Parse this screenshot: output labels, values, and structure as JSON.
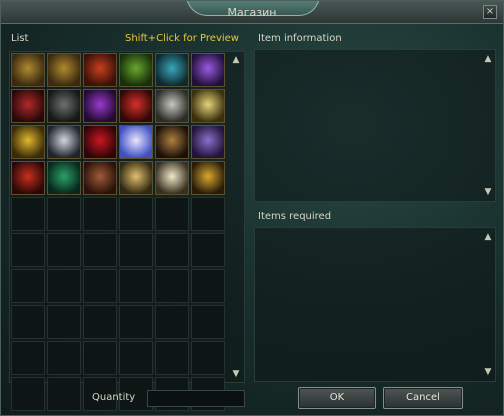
{
  "window": {
    "title": "Магазин",
    "close_glyph": "×"
  },
  "list": {
    "label": "List",
    "hint": "Shift+Click for Preview",
    "grid_columns": 6,
    "grid_rows": 10,
    "items": [
      {
        "icon": "gold-coin-icon",
        "colors": [
          "#b08a30",
          "#3a2a10"
        ]
      },
      {
        "icon": "gold-coin-icon",
        "colors": [
          "#b08a30",
          "#3a2a10"
        ]
      },
      {
        "icon": "red-armor-icon",
        "colors": [
          "#c8401c",
          "#3a1008"
        ]
      },
      {
        "icon": "green-armor-icon",
        "colors": [
          "#6aa62c",
          "#18300a"
        ]
      },
      {
        "icon": "teal-armor-icon",
        "colors": [
          "#3aa6b8",
          "#0c2a30"
        ]
      },
      {
        "icon": "purple-armor-icon",
        "colors": [
          "#9a5ae0",
          "#20103a"
        ]
      },
      {
        "icon": "crimson-armor-icon",
        "colors": [
          "#b02a2a",
          "#2a0808"
        ]
      },
      {
        "icon": "dark-armor-icon",
        "colors": [
          "#6e7070",
          "#161818"
        ]
      },
      {
        "icon": "violet-armor-icon",
        "colors": [
          "#9a3ad0",
          "#220a30"
        ]
      },
      {
        "icon": "scarlet-armor-icon",
        "colors": [
          "#d8302a",
          "#300808"
        ]
      },
      {
        "icon": "silver-armor-icon",
        "colors": [
          "#c8c8c0",
          "#2c2c28"
        ]
      },
      {
        "icon": "gold-armor-icon",
        "colors": [
          "#e6d27a",
          "#3a300e"
        ]
      },
      {
        "icon": "gold-winged-armor-icon",
        "colors": [
          "#e0b830",
          "#3a2a08"
        ]
      },
      {
        "icon": "white-armor-icon",
        "colors": [
          "#d0d6e0",
          "#20242c"
        ]
      },
      {
        "icon": "red-heart-icon",
        "colors": [
          "#c81820",
          "#300408"
        ]
      },
      {
        "icon": "light-orb-icon",
        "colors": [
          "#e8e6ff",
          "#4050c0"
        ]
      },
      {
        "icon": "dark-gold-armor-icon",
        "colors": [
          "#b08040",
          "#1a1008"
        ]
      },
      {
        "icon": "purple-gold-armor-icon",
        "colors": [
          "#8a70c8",
          "#20143a"
        ]
      },
      {
        "icon": "red-winged-armor-icon",
        "colors": [
          "#c83020",
          "#2a0806"
        ]
      },
      {
        "icon": "green-robe-icon",
        "colors": [
          "#2aa06a",
          "#08281a"
        ]
      },
      {
        "icon": "bronze-armor-icon",
        "colors": [
          "#a05a3a",
          "#2a120a"
        ]
      },
      {
        "icon": "gold-white-armor-icon",
        "colors": [
          "#e0c070",
          "#302810"
        ]
      },
      {
        "icon": "ivory-armor-icon",
        "colors": [
          "#f0e8c8",
          "#383020"
        ]
      },
      {
        "icon": "gold-dark-armor-icon",
        "colors": [
          "#d8a830",
          "#281c08"
        ]
      }
    ]
  },
  "item_info": {
    "label": "Item information"
  },
  "items_required": {
    "label": "Items required"
  },
  "quantity": {
    "label": "Quantity",
    "value": ""
  },
  "buttons": {
    "ok": "OK",
    "cancel": "Cancel"
  },
  "scroll": {
    "up_glyph": "▲",
    "down_glyph": "▼"
  }
}
